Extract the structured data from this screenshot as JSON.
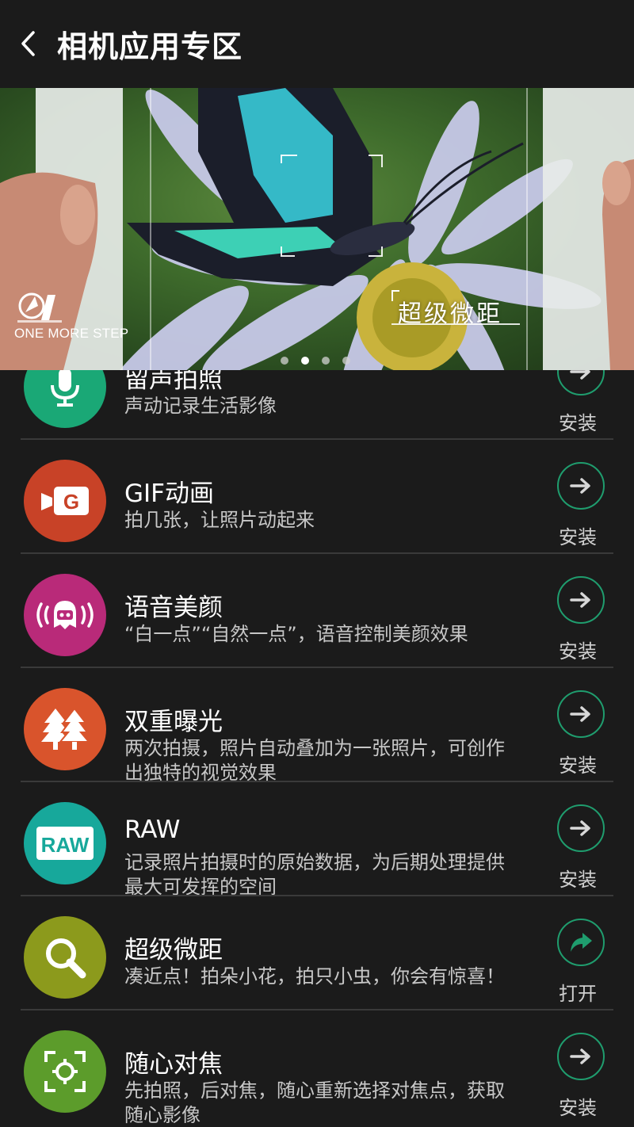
{
  "header": {
    "title": "相机应用专区",
    "back_icon": "back-arrow-icon"
  },
  "banner": {
    "brand_text": "ONE MORE STEP",
    "caption": "超级微距",
    "page_count": 4,
    "active_page": 1
  },
  "items": [
    {
      "title": "留声拍照",
      "desc": "声动记录生活影像",
      "action": "安装",
      "icon": "microphone-icon",
      "color": "#1aa876"
    },
    {
      "title": "GIF动画",
      "desc": "拍几张，让照片动起来",
      "action": "安装",
      "icon": "gif-camera-icon",
      "color": "#c84227"
    },
    {
      "title": "语音美颜",
      "desc": "“白一点”“自然一点”，语音控制美颜效果",
      "action": "安装",
      "icon": "voice-face-icon",
      "color": "#b92a79"
    },
    {
      "title": "双重曝光",
      "desc": "两次拍摄，照片自动叠加为一张照片，可创作出独特的视觉效果",
      "action": "安装",
      "icon": "trees-icon",
      "color": "#d9542c"
    },
    {
      "title": "RAW",
      "desc": "记录照片拍摄时的原始数据，为后期处理提供最大可发挥的空间",
      "action": "安装",
      "icon": "raw-icon",
      "color": "#17a89b"
    },
    {
      "title": "超级微距",
      "desc": "凑近点！拍朵小花，拍只小虫，你会有惊喜！",
      "action": "打开",
      "icon": "magnifier-icon",
      "color": "#8c9a1c"
    },
    {
      "title": "随心对焦",
      "desc": "先拍照，后对焦，随心重新选择对焦点，获取随心影像",
      "action": "安装",
      "icon": "focus-icon",
      "color": "#5c9c2b"
    }
  ],
  "colors": {
    "background": "#1b1b1b",
    "accent": "#1f9d6e",
    "divider": "#3a3a3a"
  }
}
